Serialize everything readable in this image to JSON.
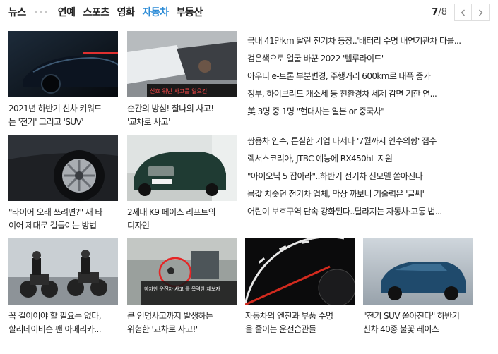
{
  "nav": {
    "tabs": [
      {
        "label": "뉴스",
        "active": false
      },
      {
        "label": "연예",
        "active": false
      },
      {
        "label": "스포츠",
        "active": false
      },
      {
        "label": "영화",
        "active": false
      },
      {
        "label": "자동차",
        "active": true
      },
      {
        "label": "부동산",
        "active": false
      }
    ],
    "page_current": "7",
    "page_total": "/8",
    "prev_icon": "chevron-left-icon",
    "next_icon": "chevron-right-icon"
  },
  "cards_row1": [
    {
      "line1": "2021년 하반기 신차 키워드",
      "line2": "는 '전기' 그리고 'SUV'"
    },
    {
      "line1": "순간의 방심! 찰나의 사고!",
      "line2": "'교차로 사고'",
      "overlay": "신호 위반 사고를 일으킨"
    }
  ],
  "list1": [
    "국내 41만km 달린 전기차 등장..'배터리 수명 내연기관차 다를...",
    "검은색으로 얼굴 바꾼 2022 '텔루라이드'",
    "아우디 e-트론 부분변경, 주행거리 600km로 대폭 증가",
    "정부, 하이브리드 개소세 등 친환경차 세제 감면 기한 연...",
    "美 3명 중 1명 \"현대차는 일본 or 중국차\""
  ],
  "cards_row2": [
    {
      "line1": "\"타이어 오래 쓰려면?\" 새 타",
      "line2": "이어 제대로 길들이는 방법"
    },
    {
      "line1": "2세대 K9 페이스 리프트의",
      "line2": "디자인"
    }
  ],
  "list2": [
    "쌍용차 인수, 튼실한 기업 나서나 '7월까지 인수의향' 접수",
    "렉서스코리아, JTBC 예능에 RX450hL 지원",
    "\"아이오닉 5 잡아라\"..하반기 전기차 신모델 쏟아진다",
    "몸값 치솟던 전기차 업체, 막상 까보니 기술력은 '글쎄'",
    "어린이 보호구역 단속 강화된다..달라지는 자동차·교통 법..."
  ],
  "cards_row3": [
    {
      "line1": "꼭 길이어야 할 필요는 없다,",
      "line2": "할리데이비슨 팬 아메리카..."
    },
    {
      "line1": "큰 인명사고까지 발생하는",
      "line2": "위험한 '교차로 사고!'",
      "overlay": "하차한 운전자 사고 를 목격한 제보자"
    },
    {
      "line1": "자동차의 엔진과 부품 수명",
      "line2": "을 줄이는 운전습관들"
    },
    {
      "line1": "\"전기 SUV 쏟아진다\" 하반기",
      "line2": "신차 40종 불꽃 레이스"
    }
  ],
  "colors": {
    "accent": "#2b8bd6",
    "text": "#222222"
  }
}
